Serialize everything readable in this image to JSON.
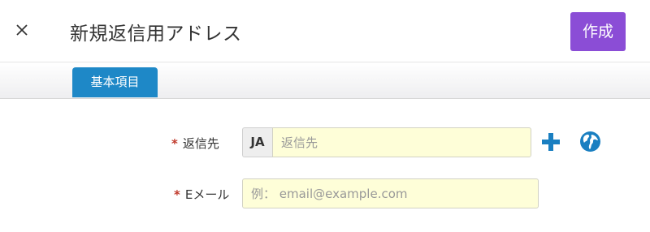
{
  "header": {
    "close_symbol": "×",
    "title": "新規返信用アドレス",
    "create_label": "作成"
  },
  "tabs": [
    {
      "label": "基本項目",
      "active": true
    }
  ],
  "form": {
    "required_mark": "*",
    "reply_to": {
      "label": "返信先",
      "language_code": "JA",
      "placeholder": "返信先",
      "value": ""
    },
    "email": {
      "label": "Eメール",
      "placeholder": "例： email@example.com",
      "value": ""
    },
    "icons": [
      "plus-icon",
      "globe-icon"
    ]
  },
  "colors": {
    "accent_purple": "#8b4dd6",
    "tab_blue": "#1e88c7",
    "icon_blue": "#1a7fc1",
    "required_red": "#c0392b",
    "input_bg": "#fefed8"
  }
}
